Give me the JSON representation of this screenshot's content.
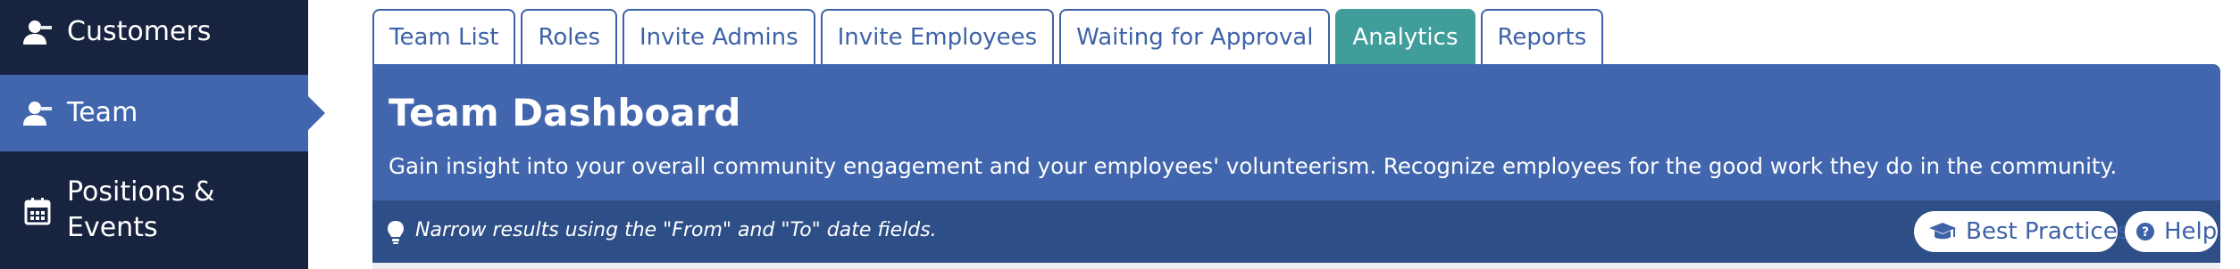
{
  "sidebar": {
    "items": [
      {
        "label": "Customers",
        "icon": "user-icon",
        "active": false
      },
      {
        "label": "Team",
        "icon": "user-icon",
        "active": true
      },
      {
        "label": "Positions & Events",
        "icon": "calendar-icon",
        "active": false
      }
    ]
  },
  "tabs": [
    {
      "label": "Team List",
      "active": false
    },
    {
      "label": "Roles",
      "active": false
    },
    {
      "label": "Invite Admins",
      "active": false
    },
    {
      "label": "Invite Employees",
      "active": false
    },
    {
      "label": "Waiting for Approval",
      "active": false
    },
    {
      "label": "Analytics",
      "active": true
    },
    {
      "label": "Reports",
      "active": false
    }
  ],
  "panel": {
    "title": "Team Dashboard",
    "description": "Gain insight into your overall community engagement and your employees' volunteerism. Recognize employees for the good work they do in the community."
  },
  "hint": {
    "icon": "lightbulb-icon",
    "text": "Narrow results using the \"From\" and \"To\" date fields."
  },
  "actions": {
    "best_practices_label": "Best Practices",
    "best_practices_icon": "graduation-cap-icon",
    "help_label": "Help",
    "help_icon": "question-circle-icon"
  },
  "colors": {
    "sidebar_bg": "#18233f",
    "active_nav": "#4166ae",
    "active_tab": "#3f9e9a",
    "panel_bg": "#4166ae",
    "hint_bg": "#2e4e87"
  }
}
